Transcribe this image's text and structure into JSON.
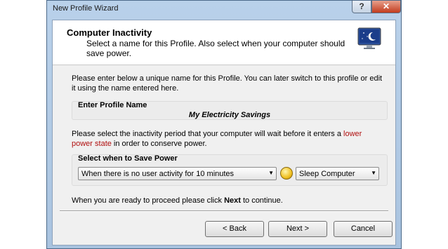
{
  "window": {
    "title": "New Profile Wizard",
    "help_label": "?",
    "close_label": "✕"
  },
  "header": {
    "title": "Computer Inactivity",
    "subtitle": "Select a name for this Profile. Also select when your computer should save power."
  },
  "intro": {
    "text": "Please enter below a unique name for this Profile. You can later switch to this profile or edit it using the name entered here."
  },
  "profile_group": {
    "label": "Enter Profile Name",
    "value": "My Electricity Savings"
  },
  "inactivity": {
    "text_before": "Please select the inactivity period that your computer will wait before it enters a ",
    "link_text": "lower power state",
    "text_after": " in order to conserve power."
  },
  "save_group": {
    "label": "Select when to Save Power",
    "period_value": "When there is no user activity for 10 minutes",
    "action_value": "Sleep Computer"
  },
  "proceed": {
    "before": "When you are ready to proceed please click ",
    "bold": "Next",
    "after": " to continue."
  },
  "buttons": {
    "back": "< Back",
    "next": "Next >",
    "cancel": "Cancel"
  },
  "colors": {
    "accent_red": "#b01010",
    "frame": "#b9d1ea"
  }
}
